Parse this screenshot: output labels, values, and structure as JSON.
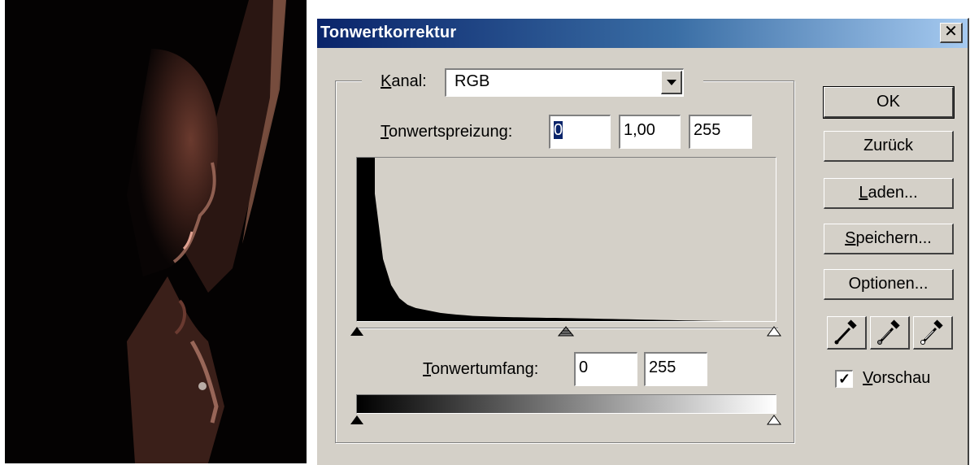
{
  "dialog": {
    "title": "Tonwertkorrektur",
    "close_glyph": "✕",
    "channel": {
      "label_key": "K",
      "label_rest": "anal:",
      "value": "RGB"
    },
    "input_levels": {
      "label_key": "T",
      "label_rest": "onwertspreizung:",
      "black": "0",
      "gamma": "1,00",
      "white": "255"
    },
    "output_levels": {
      "label_key": "T",
      "label_rest": "onwertumfang:",
      "black": "0",
      "white": "255"
    },
    "histogram": {
      "description_values": [
        100,
        78,
        38,
        22,
        14,
        10,
        8,
        7,
        6,
        5,
        4.5,
        4,
        3.6,
        3.2,
        3,
        2.8,
        2.6,
        2.5,
        2.4,
        2.3,
        2.2,
        2.1,
        2,
        2,
        1.9,
        1.8,
        1.7,
        1.6,
        1.5,
        1.4,
        1.3,
        1.2,
        1.1,
        1,
        0.9,
        0.8,
        0.7,
        0.6,
        0.5,
        0.4,
        0.3,
        0.2,
        0.1,
        0.05,
        0,
        0,
        0,
        0,
        0,
        0
      ]
    },
    "buttons": {
      "ok": "OK",
      "reset": "Zurück",
      "load_key": "L",
      "load_rest": "aden...",
      "save_key": "S",
      "save_rest": "peichern...",
      "options": "Optionen..."
    },
    "eyedroppers": [
      "eyedropper-black-icon",
      "eyedropper-gray-icon",
      "eyedropper-white-icon"
    ],
    "preview": {
      "checked": true,
      "check_glyph": "✓",
      "label_key": "V",
      "label_rest": "orschau"
    },
    "colors": {
      "title_start": "#0a246a",
      "title_end": "#a6caf0",
      "face": "#d4d0c8"
    }
  }
}
